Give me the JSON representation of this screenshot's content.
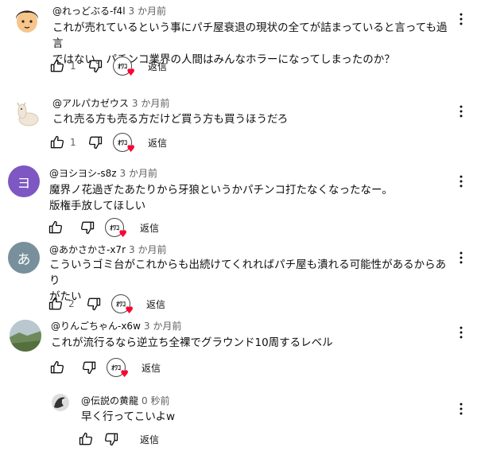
{
  "comments": [
    {
      "author": "@れっどぶる-f4l",
      "time": "3 か月前",
      "text": "これが売れているという事にパチ屋衰退の現状の全てが詰まっていると言っても過言\nではない。パチンコ業界の人間はみんなホラーになってしまったのか？",
      "likes": "1",
      "reply_label": "返信",
      "avatar_color": "#f7c48a"
    },
    {
      "author": "@アルパカゼウス",
      "time": "3 か月前",
      "text": "これ売る方も売る方だけど買う方も買うほうだろ",
      "likes": "1",
      "reply_label": "返信",
      "avatar_color": "#efe6d8"
    },
    {
      "author": "@ヨシヨシ-s8z",
      "time": "3 か月前",
      "text": "魔界ノ花過ぎたあたりから牙狼というかパチンコ打たなくなったなー。\n版権手放してほしい",
      "likes": "",
      "reply_label": "返信",
      "avatar_letter": "ヨ",
      "avatar_color": "#7e57c2"
    },
    {
      "author": "@あかさかさ-x7r",
      "time": "3 か月前",
      "text": "こういうゴミ台がこれからも出続けてくれればパチ屋も潰れる可能性があるからあり\nがたい",
      "likes": "2",
      "reply_label": "返信",
      "avatar_letter": "あ",
      "avatar_color": "#78909c"
    },
    {
      "author": "@りんごちゃん-x6w",
      "time": "3 か月前",
      "text": "これが流行るなら逆立ち全裸でグラウンド10周するレベル",
      "likes": "",
      "reply_label": "返信",
      "avatar_color": "#7d8f6e"
    }
  ],
  "reply": {
    "author": "@伝説の黄龍",
    "time": "0 秒前",
    "text": "早く行ってこいよw",
    "reply_label": "返信",
    "avatar_color": "#444444"
  },
  "creator_badge_text": "ｵﾜｺ",
  "colors": {
    "text": "#0f0f0f",
    "secondary": "#606060",
    "heart": "#ff0033"
  }
}
